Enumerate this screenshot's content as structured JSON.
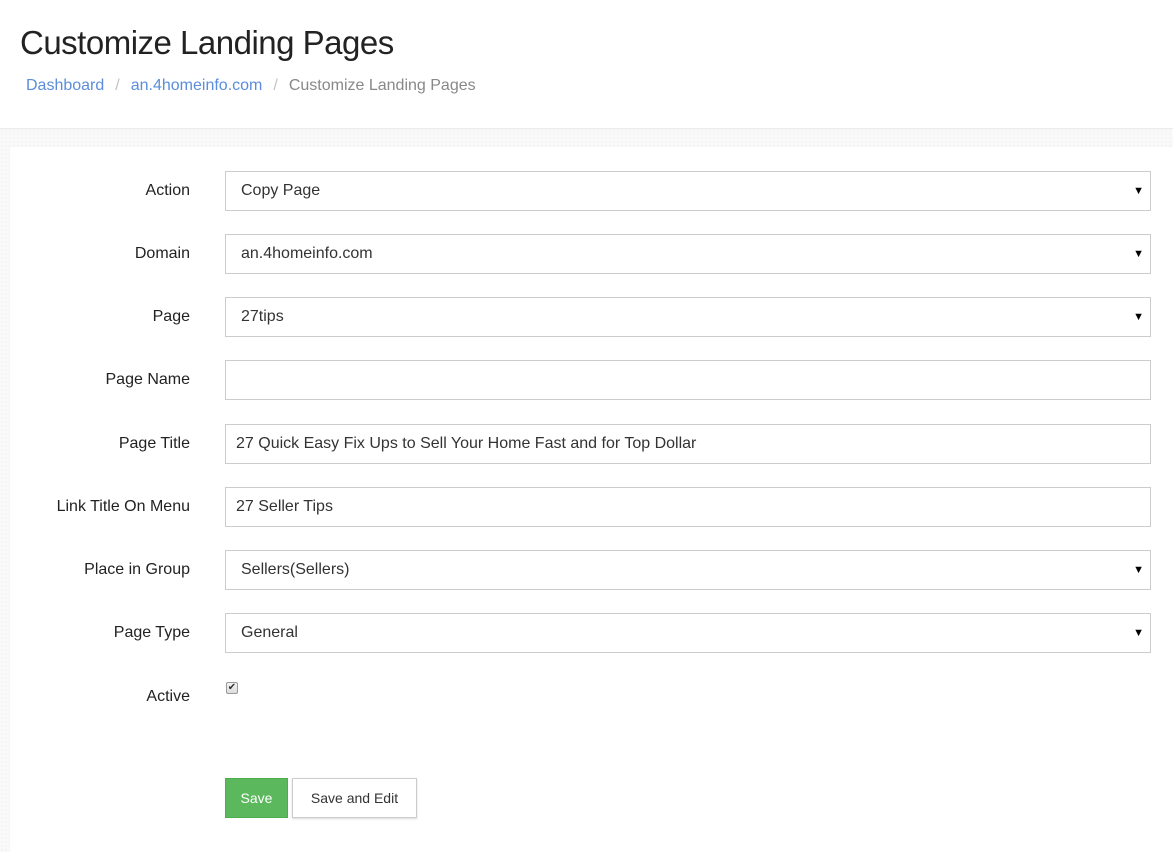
{
  "header": {
    "title": "Customize Landing Pages",
    "breadcrumb": {
      "items": [
        "Dashboard",
        "an.4homeinfo.com"
      ],
      "separator": "/",
      "current": "Customize Landing Pages"
    }
  },
  "form": {
    "action": {
      "label": "Action",
      "value": "Copy Page",
      "arrow": "▼"
    },
    "domain": {
      "label": "Domain",
      "value": "an.4homeinfo.com",
      "arrow": "▼"
    },
    "page": {
      "label": "Page",
      "value": "27tips",
      "arrow": "▼"
    },
    "page_name": {
      "label": "Page Name",
      "value": ""
    },
    "page_title": {
      "label": "Page Title",
      "value": "27 Quick Easy Fix Ups to Sell Your Home Fast and for Top Dollar"
    },
    "link_title": {
      "label": "Link Title On Menu",
      "value": "27 Seller Tips"
    },
    "place_in_group": {
      "label": "Place in Group",
      "value": "Sellers(Sellers)",
      "arrow": "▼"
    },
    "page_type": {
      "label": "Page Type",
      "value": "General",
      "arrow": "▼"
    },
    "active": {
      "label": "Active",
      "checked": true,
      "mark": "✔"
    }
  },
  "buttons": {
    "save": "Save",
    "save_and_edit": "Save and Edit"
  },
  "colors": {
    "link": "#5b8ddb",
    "save_button": "#5cb85c",
    "border": "#cccccc"
  }
}
